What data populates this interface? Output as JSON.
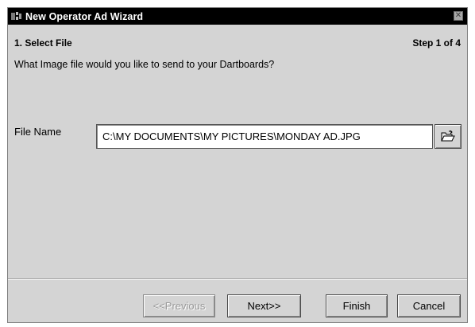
{
  "window": {
    "title": "New Operator Ad Wizard",
    "close_glyph": "✕",
    "app_icon": "dartboard-app-icon"
  },
  "wizard": {
    "section_title": "1. Select File",
    "step_indicator": "Step 1 of 4",
    "question": "What Image file would you like to send to your Dartboards?"
  },
  "file": {
    "label": "File Name",
    "value": "C:\\MY DOCUMENTS\\MY PICTURES\\MONDAY AD.JPG",
    "browse_icon": "open-folder-icon"
  },
  "buttons": {
    "previous": "<<Previous",
    "next": "Next>>",
    "finish": "Finish",
    "cancel": "Cancel"
  },
  "states": {
    "previous_enabled": false
  }
}
